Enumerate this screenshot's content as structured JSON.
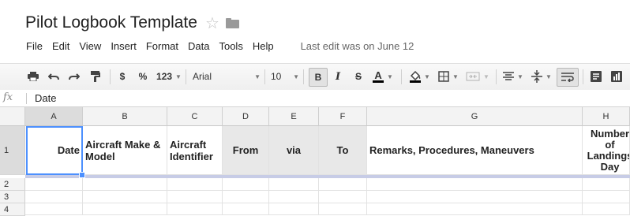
{
  "doc": {
    "title": "Pilot Logbook Template"
  },
  "menu": {
    "items": [
      "File",
      "Edit",
      "View",
      "Insert",
      "Format",
      "Data",
      "Tools",
      "Help"
    ],
    "last_edit": "Last edit was on June 12"
  },
  "toolbar": {
    "currency": "$",
    "percent": "%",
    "more_formats": "123",
    "font": "Arial",
    "font_size": "10",
    "bold": "B",
    "italic": "I",
    "strike": "S",
    "text_color_letter": "A"
  },
  "formula_bar": {
    "fx": "fx",
    "value": "Date"
  },
  "grid": {
    "columns": [
      "A",
      "B",
      "C",
      "D",
      "E",
      "F",
      "G",
      "H"
    ],
    "rows": [
      "1",
      "2",
      "3",
      "4"
    ],
    "row1": {
      "a": "Date",
      "b": "Aircraft Make & Model",
      "c": "Aircraft Identifier",
      "d": "From",
      "e": "via",
      "f": "To",
      "g": "Remarks, Procedures, Maneuvers",
      "h": "Number of Landings Day"
    }
  }
}
